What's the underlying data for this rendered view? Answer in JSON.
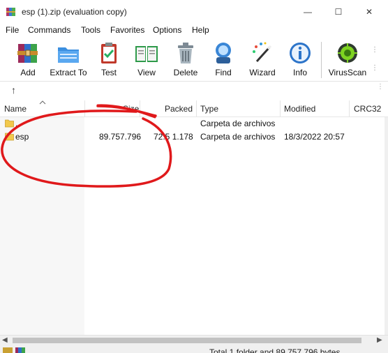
{
  "window": {
    "title": "esp (1).zip (evaluation copy)",
    "minimize_glyph": "—",
    "maximize_glyph": "☐",
    "close_glyph": "✕"
  },
  "menu": [
    "File",
    "Commands",
    "Tools",
    "Favorites",
    "Options",
    "Help"
  ],
  "toolbar": {
    "add": "Add",
    "extract_to": "Extract To",
    "test": "Test",
    "view": "View",
    "delete": "Delete",
    "find": "Find",
    "wizard": "Wizard",
    "info": "Info",
    "virusscan": "VirusScan"
  },
  "path": {
    "up_glyph": "↑"
  },
  "columns": {
    "name": "Name",
    "size": "Size",
    "packed": "Packed",
    "type": "Type",
    "modified": "Modified",
    "crc": "CRC32"
  },
  "rows": [
    {
      "name": "..",
      "size": "",
      "packed": "",
      "type": "Carpeta de archivos",
      "modified": ""
    },
    {
      "name": "esp",
      "size": "89.757.796",
      "packed": "72.5  1.178",
      "type": "Carpeta de archivos",
      "modified": "18/3/2022 20:57"
    }
  ],
  "status": {
    "text": "Total 1 folder and 89.757.796 bytes"
  },
  "colors": {
    "annotation": "#e0191b",
    "folder": "#f2c94c",
    "accent": "#2c74c9"
  }
}
